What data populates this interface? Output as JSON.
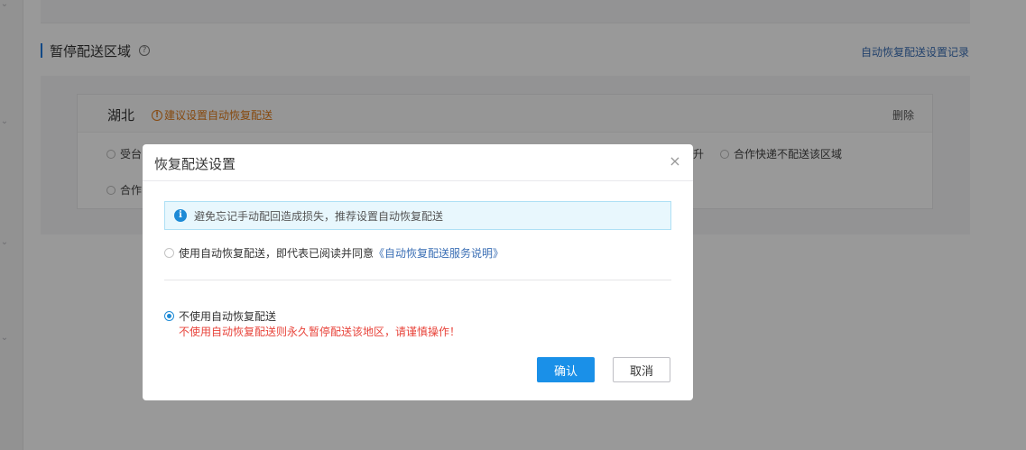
{
  "section": {
    "title": "暂停配送区域",
    "help_icon": "?",
    "record_link": "自动恢复配送设置记录"
  },
  "area_card": {
    "region": "湖北",
    "tip_icon": "!",
    "tip": "建议设置自动恢复配送",
    "delete": "删除",
    "options": [
      "受台",
      "升",
      "合作快递不配送该区域",
      "合作"
    ]
  },
  "dialog": {
    "title": "恢复配送设置",
    "close_icon": "×",
    "alert_icon": "i",
    "alert_text": "避免忘记手动配回造成损失，推荐设置自动恢复配送",
    "option_auto": {
      "text": "使用自动恢复配送，即代表已阅读并同意",
      "link": "《自动恢复配送服务说明》",
      "checked": false
    },
    "option_manual": {
      "text": "不使用自动恢复配送",
      "checked": true,
      "warning": "不使用自动恢复配送则永久暂停配送该地区，请谨慎操作！"
    },
    "confirm": "确认",
    "cancel": "取消"
  },
  "colors": {
    "accent": "#1a90e8",
    "link": "#3b6fb5",
    "warning": "#e8443b",
    "tip": "#e07b1a"
  }
}
